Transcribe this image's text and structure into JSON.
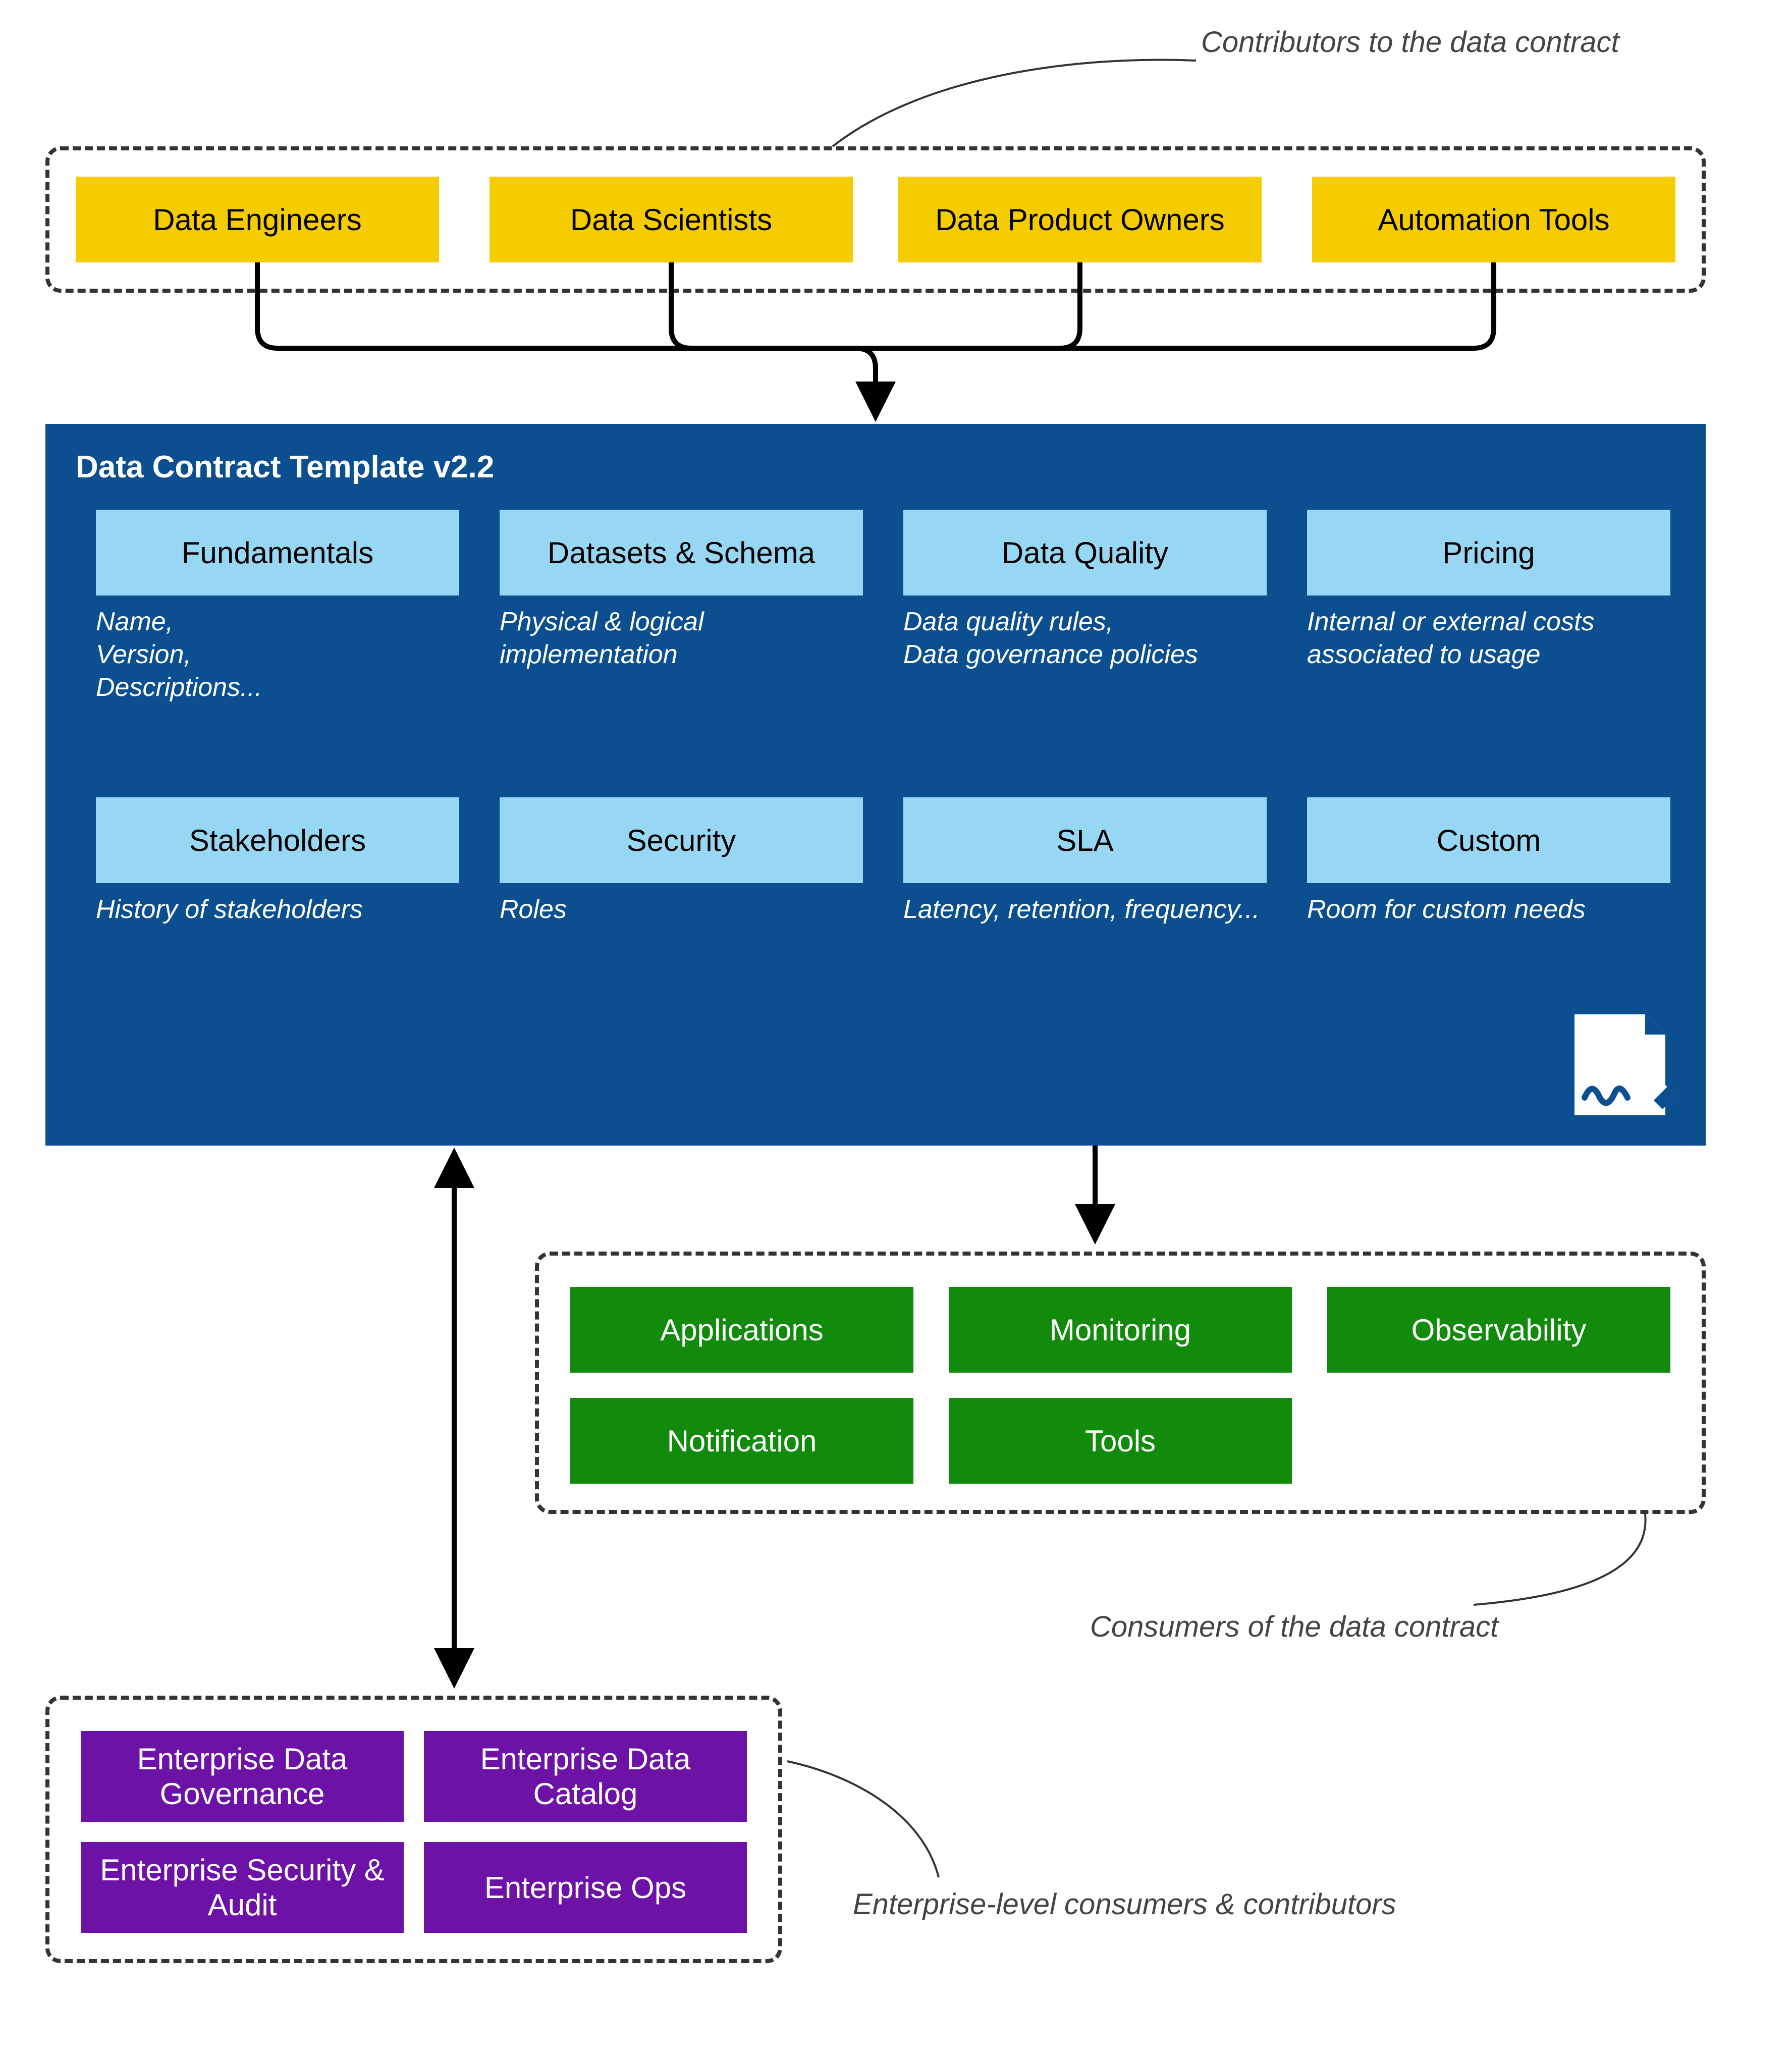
{
  "annotations": {
    "contributors": "Contributors to the data contract",
    "consumers": "Consumers of the data contract",
    "enterprise": "Enterprise-level consumers & contributors"
  },
  "contributors": {
    "items": [
      "Data Engineers",
      "Data Scientists",
      "Data Product Owners",
      "Automation Tools"
    ]
  },
  "template": {
    "title": "Data Contract Template v2.2",
    "tiles": [
      {
        "label": "Fundamentals",
        "desc": "Name,\nVersion,\nDescriptions..."
      },
      {
        "label": "Datasets & Schema",
        "desc": "Physical & logical implementation"
      },
      {
        "label": "Data Quality",
        "desc": "Data quality rules,\nData governance policies"
      },
      {
        "label": "Pricing",
        "desc": "Internal or external costs associated to usage"
      },
      {
        "label": "Stakeholders",
        "desc": "History of stakeholders"
      },
      {
        "label": "Security",
        "desc": "Roles"
      },
      {
        "label": "SLA",
        "desc": "Latency, retention, frequency..."
      },
      {
        "label": "Custom",
        "desc": "Room for custom needs"
      }
    ]
  },
  "consumers": {
    "items": [
      "Applications",
      "Monitoring",
      "Observability",
      "Notification",
      "Tools"
    ]
  },
  "enterprise": {
    "items": [
      "Enterprise Data Governance",
      "Enterprise Data Catalog",
      "Enterprise Security & Audit",
      "Enterprise Ops"
    ]
  }
}
